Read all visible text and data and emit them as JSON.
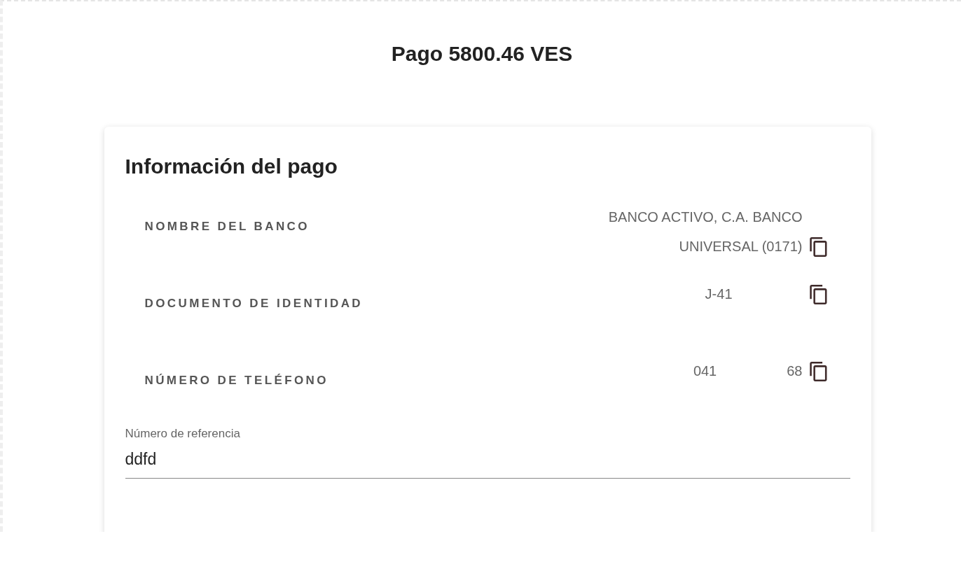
{
  "title": "Pago 5800.46 VES",
  "card": {
    "heading": "Información del pago",
    "rows": [
      {
        "label": "NOMBRE DEL BANCO",
        "segments": [
          "BANCO ACTIVO, C.A. BANCO UNIVERSAL (0171)"
        ],
        "redacted": false
      },
      {
        "label": "DOCUMENTO DE IDENTIDAD",
        "segments": [
          "J-41"
        ],
        "redacted": true
      },
      {
        "label": "NÚMERO DE TELÉFONO",
        "segments": [
          "041",
          "68"
        ],
        "redacted": true
      }
    ],
    "reference_field": {
      "label": "Número de referencia",
      "value": "ddfd"
    }
  }
}
